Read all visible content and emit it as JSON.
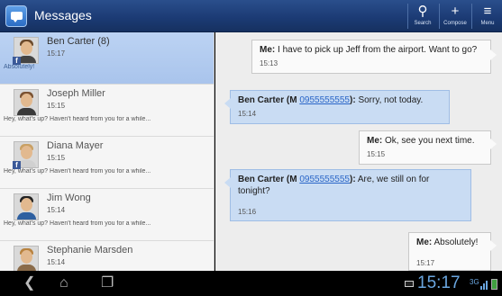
{
  "app": {
    "title": "Messages"
  },
  "actions": [
    {
      "label": "Search",
      "glyph": "⚲"
    },
    {
      "label": "Compose",
      "glyph": "+"
    },
    {
      "label": "Menu",
      "glyph": "≡"
    }
  ],
  "conversations": [
    {
      "name": "Ben Carter (8)",
      "time": "15:17",
      "snippet": "Absolutely!",
      "selected": true
    },
    {
      "name": "Joseph Miller",
      "time": "15:15",
      "snippet": "Hey, what's up? Haven't heard from you for a while..."
    },
    {
      "name": "Diana Mayer",
      "time": "15:15",
      "snippet": "Hey, what's up? Haven't heard from you for a while..."
    },
    {
      "name": "Jim Wong",
      "time": "15:14",
      "snippet": "Hey, what's up? Haven't heard from you for a while..."
    },
    {
      "name": "Stephanie Marsden",
      "time": "15:14",
      "snippet": ""
    }
  ],
  "messages": [
    {
      "sender": "Me:",
      "text": "I have to pick up Jeff from the airport. Want to go?",
      "time": "15:13"
    },
    {
      "sender": "Ben Carter (M ",
      "number": "0955555555",
      "sender_end": "):",
      "text": "Sorry, not today.",
      "time": "15:14"
    },
    {
      "sender": "Me:",
      "text": "Ok, see you next time.",
      "time": "15:15"
    },
    {
      "sender": "Ben Carter (M ",
      "number": "0955555555",
      "sender_end": "):",
      "text": "Are, we still on for tonight?",
      "time": "15:16"
    },
    {
      "sender": "Me:",
      "text": "Absolutely!",
      "time": "15:17"
    }
  ],
  "status": {
    "clock": "15:17",
    "signal": "3G"
  },
  "colors": {
    "titlebar": "#1b3a73",
    "selected_row": "#bcd3f3",
    "incoming_bubble": "#c9dcf3",
    "outgoing_bubble": "#fafafa",
    "clock": "#6aa6e0"
  }
}
